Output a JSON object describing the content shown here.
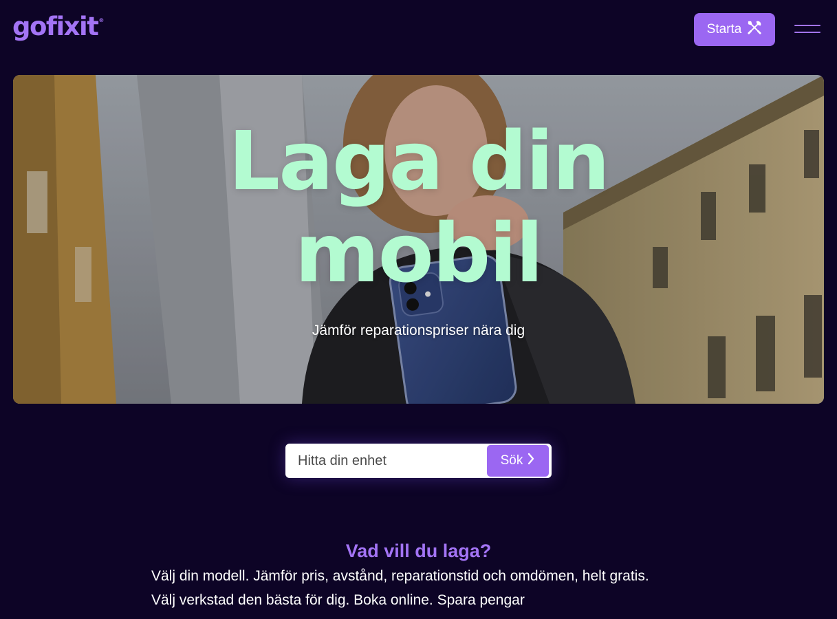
{
  "header": {
    "logo_text": "gofixit",
    "logo_mark": "®",
    "start_button_label": "Starta",
    "start_button_icon": "tools-icon",
    "menu_icon": "hamburger-menu-icon"
  },
  "hero": {
    "title": "Laga din\nmobil",
    "subtitle": "Jämför reparationspriser nära dig"
  },
  "search": {
    "placeholder": "Hitta din enhet",
    "value": "",
    "button_label": "Sök",
    "button_icon": "chevron-right-icon"
  },
  "section": {
    "heading": "Vad vill du laga?",
    "line1": "Välj din modell. Jämför pris, avstånd, reparationstid och omdömen, helt gratis.",
    "line2": "Välj verkstad den bästa för dig. Boka online. Spara pengar"
  },
  "colors": {
    "background": "#0d0426",
    "brand_purple": "#9b67f2",
    "logo_purple": "#a374f5",
    "hero_title_mint": "#b3fbd1",
    "text_white": "#ffffff"
  }
}
